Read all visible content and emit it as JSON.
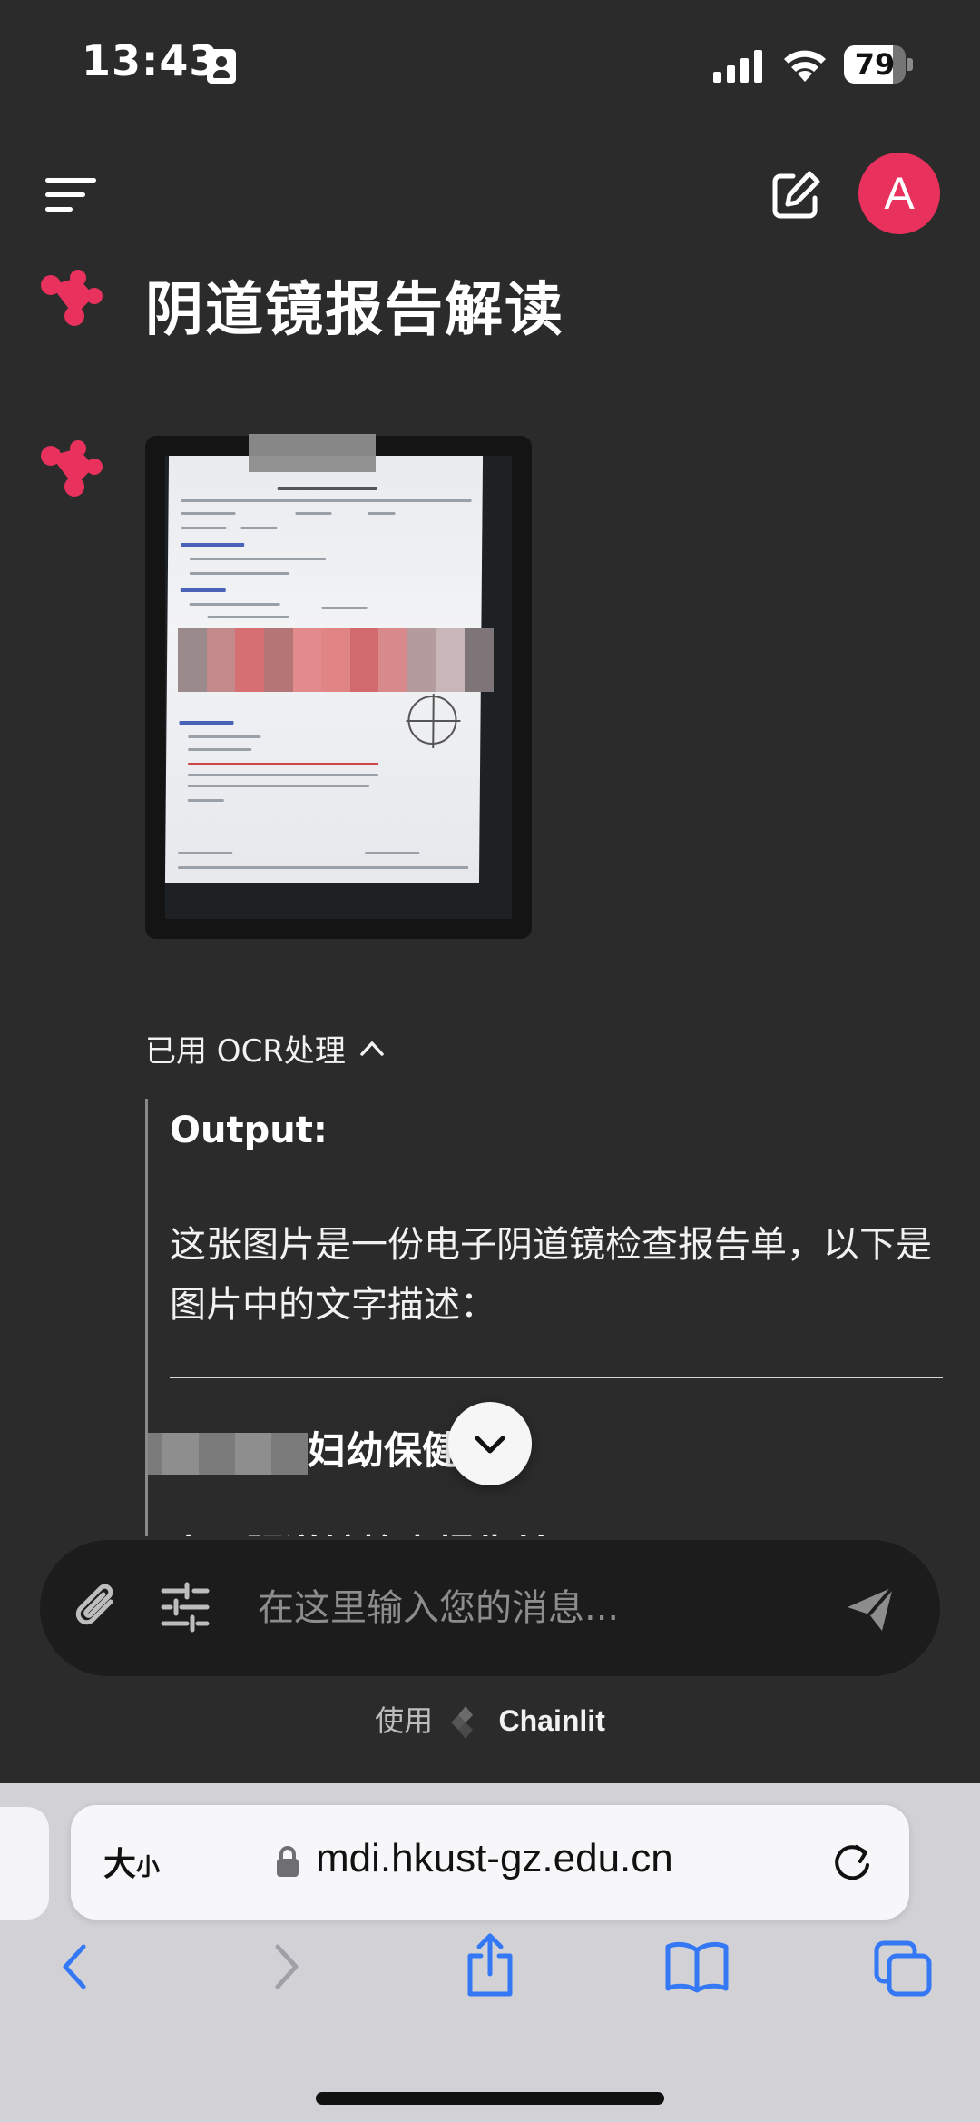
{
  "status_bar": {
    "time": "13:43",
    "battery": "79"
  },
  "header": {
    "avatar_letter": "A"
  },
  "thread": {
    "title": "阴道镜报告解读"
  },
  "step": {
    "label": "已用 OCR处理",
    "output_label": "Output:",
    "output_text": "这张图片是一份电子阴道镜检查报告单，以下是图片中的文字描述：",
    "hospital_suffix": "妇幼保健",
    "truncated_heading": "电子阴道镜检查报告单"
  },
  "composer": {
    "placeholder": "在这里输入您的消息..."
  },
  "footer": {
    "prefix": "使用",
    "brand": "Chainlit"
  },
  "browser": {
    "reader_label": "大",
    "reader_small": "小",
    "url": "mdi.hkust-gz.edu.cn"
  },
  "colors": {
    "accent": "#e8315c",
    "background": "#2b2b2b",
    "safari_blue": "#3478f6"
  }
}
